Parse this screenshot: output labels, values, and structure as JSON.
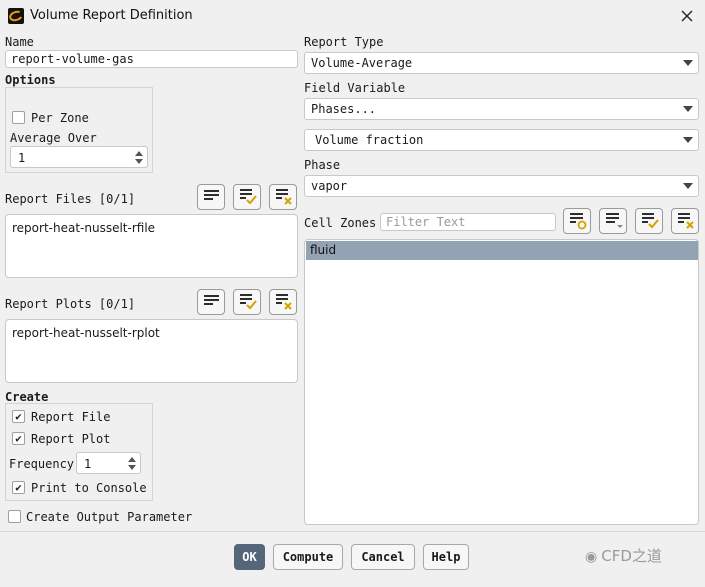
{
  "window": {
    "title": "Volume Report Definition"
  },
  "name_field": {
    "label": "Name",
    "value": "report-volume-gas"
  },
  "options": {
    "label": "Options",
    "per_zone_label": "Per Zone",
    "per_zone_checked": false,
    "average_over_label": "Average Over",
    "average_over_value": "1"
  },
  "report_files": {
    "label": "Report Files [0/1]",
    "items": [
      "report-heat-nusselt-rfile"
    ]
  },
  "report_plots": {
    "label": "Report Plots [0/1]",
    "items": [
      "report-heat-nusselt-rplot"
    ]
  },
  "create": {
    "label": "Create",
    "report_file_label": "Report File",
    "report_file_checked": true,
    "report_plot_label": "Report Plot",
    "report_plot_checked": true,
    "frequency_label": "Frequency",
    "frequency_value": "1",
    "print_to_console_label": "Print to Console",
    "print_to_console_checked": true
  },
  "create_output_parameter": {
    "label": "Create Output Parameter",
    "checked": false
  },
  "report_type": {
    "label": "Report Type",
    "value": "Volume-Average"
  },
  "field_variable": {
    "label": "Field Variable",
    "category": "Phases...",
    "value": "Volume fraction"
  },
  "phase": {
    "label": "Phase",
    "value": "vapor"
  },
  "cell_zones": {
    "label": "Cell Zones",
    "filter_placeholder": "Filter Text",
    "items": [
      "fluid"
    ],
    "selected": "fluid"
  },
  "buttons": {
    "ok": "OK",
    "compute": "Compute",
    "cancel": "Cancel",
    "help": "Help"
  },
  "icons": {
    "app": "fluent-logo-icon",
    "close": "close-icon"
  },
  "colors": {
    "selection": "#93a3b3",
    "primary_button": "#55657a",
    "check_accent": "#d4a300",
    "x_accent": "#d4a300"
  },
  "watermark": "CFD之道"
}
